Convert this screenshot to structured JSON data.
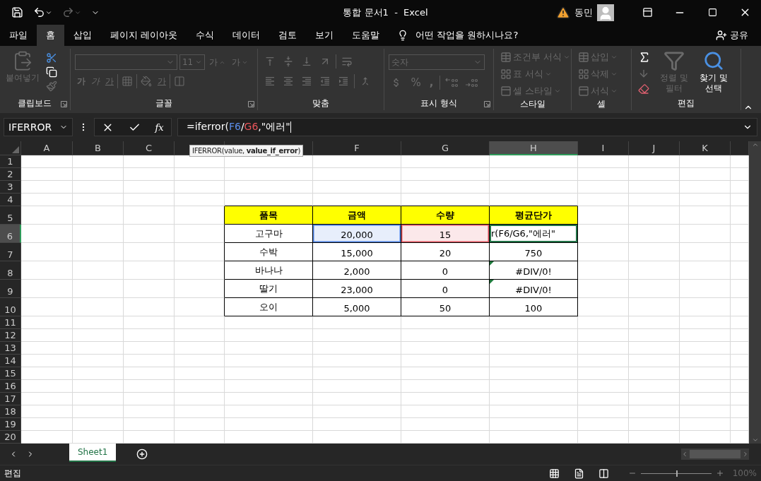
{
  "title_bar": {
    "title": "통합 문서1  -  Excel",
    "user": "동민"
  },
  "menu_tabs": [
    {
      "label": "파일",
      "selected": false
    },
    {
      "label": "홈",
      "selected": true
    },
    {
      "label": "삽입",
      "selected": false
    },
    {
      "label": "페이지 레이아웃",
      "selected": false
    },
    {
      "label": "수식",
      "selected": false
    },
    {
      "label": "데이터",
      "selected": false
    },
    {
      "label": "검토",
      "selected": false
    },
    {
      "label": "보기",
      "selected": false
    },
    {
      "label": "도움말",
      "selected": false
    }
  ],
  "tell_me": "어떤 작업을 원하시나요?",
  "share": "공유",
  "ribbon": {
    "groups": [
      {
        "kind": "clipboard",
        "label": "클립보드",
        "paste": {
          "label": "붙여넣기",
          "disabled": true
        }
      },
      {
        "kind": "font",
        "label": "글꼴",
        "disabled": true,
        "font_size": "11",
        "buttons": [
          {
            "kind": "grow",
            "label": "가"
          },
          {
            "kind": "shrink",
            "label": "가"
          },
          {
            "kind": "bold",
            "label": "가"
          },
          {
            "kind": "italic",
            "label": "가"
          },
          {
            "kind": "underline",
            "label": "가"
          },
          {
            "kind": "font-color",
            "label": "가"
          }
        ]
      },
      {
        "kind": "alignment",
        "label": "맞춤",
        "disabled": true
      },
      {
        "kind": "number",
        "label": "표시 형식",
        "disabled": true,
        "format": "숫자",
        "percent": "%",
        "comma": ","
      },
      {
        "kind": "list",
        "label": "스타일",
        "items": [
          {
            "label": "조건부 서식",
            "disabled": true
          },
          {
            "label": "표 서식",
            "disabled": true
          },
          {
            "label": "셀 스타일",
            "disabled": true
          }
        ]
      },
      {
        "kind": "list",
        "label": "셀",
        "items": [
          {
            "label": "삽입",
            "disabled": true
          },
          {
            "label": "삭제",
            "disabled": true
          },
          {
            "label": "서식",
            "disabled": true
          }
        ]
      },
      {
        "kind": "editing",
        "label": "편집",
        "items": [
          {
            "label": "정렬 및 필터",
            "disabled": true
          },
          {
            "label": "찾기 및 선택",
            "disabled": false
          }
        ]
      }
    ]
  },
  "formula_bar": {
    "name_box": "IFERROR",
    "function_button": "fx",
    "segments": [
      {
        "text": "=iferror(",
        "color": "#ffffff"
      },
      {
        "text": "F6",
        "color": "#5b8de8"
      },
      {
        "text": "/",
        "color": "#ffffff"
      },
      {
        "text": "G6",
        "color": "#e8555a"
      },
      {
        "text": ",\"에러\"",
        "color": "#ffffff"
      }
    ],
    "tooltip": "IFERROR(value, **value_if_error**)"
  },
  "sheet": {
    "columns": [
      {
        "label": "A",
        "selected": false
      },
      {
        "label": "B",
        "selected": false
      },
      {
        "label": "C",
        "selected": false
      },
      {
        "selected": false
      },
      {
        "selected": false
      },
      {
        "label": "F",
        "selected": false
      },
      {
        "label": "G",
        "selected": false
      },
      {
        "label": "H",
        "selected": true
      },
      {
        "label": "I",
        "selected": false
      },
      {
        "label": "J",
        "selected": false
      },
      {
        "label": "K",
        "selected": false
      }
    ],
    "rows": [
      {
        "label": "1",
        "selected": false
      },
      {
        "label": "2",
        "selected": false
      },
      {
        "label": "3",
        "selected": false
      },
      {
        "label": "4",
        "selected": false
      },
      {
        "label": "5",
        "selected": false
      },
      {
        "label": "6",
        "selected": true
      },
      {
        "label": "7",
        "selected": false
      },
      {
        "label": "8",
        "selected": false
      },
      {
        "label": "9",
        "selected": false
      },
      {
        "label": "10",
        "selected": false
      },
      {
        "label": "11",
        "selected": false
      },
      {
        "label": "12",
        "selected": false
      },
      {
        "label": "13",
        "selected": false
      },
      {
        "label": "14",
        "selected": false
      },
      {
        "label": "15",
        "selected": false
      },
      {
        "label": "16",
        "selected": false
      },
      {
        "label": "17",
        "selected": false
      },
      {
        "label": "18",
        "selected": false
      },
      {
        "label": "19",
        "selected": false
      },
      {
        "label": "20",
        "selected": false
      }
    ]
  },
  "table": {
    "header": [
      "품목",
      "금액",
      "수량",
      "평균단가"
    ],
    "rows": [
      [
        {
          "text": "고구마",
          "active": false,
          "flagged": false
        },
        {
          "text": "20,000",
          "color": "#4a7fe0",
          "active": false,
          "flagged": false
        },
        {
          "text": "15",
          "color": "#e05560",
          "active": false,
          "flagged": false
        },
        {
          "text": "r(F6/G6,\"에러\"",
          "active": true,
          "flagged": false
        }
      ],
      [
        {
          "text": "수박",
          "active": false,
          "flagged": false
        },
        {
          "text": "15,000",
          "active": false,
          "flagged": false
        },
        {
          "text": "20",
          "active": false,
          "flagged": false
        },
        {
          "text": "750",
          "active": false,
          "flagged": false
        }
      ],
      [
        {
          "text": "바나나",
          "active": false,
          "flagged": false
        },
        {
          "text": "2,000",
          "active": false,
          "flagged": false
        },
        {
          "text": "0",
          "active": false,
          "flagged": false
        },
        {
          "text": "#DIV/0!",
          "active": false,
          "flagged": true
        }
      ],
      [
        {
          "text": "딸기",
          "active": false,
          "flagged": false
        },
        {
          "text": "23,000",
          "active": false,
          "flagged": false
        },
        {
          "text": "0",
          "active": false,
          "flagged": false
        },
        {
          "text": "#DIV/0!",
          "active": false,
          "flagged": true
        }
      ],
      [
        {
          "text": "오이",
          "active": false,
          "flagged": false
        },
        {
          "text": "5,000",
          "active": false,
          "flagged": false
        },
        {
          "text": "50",
          "active": false,
          "flagged": false
        },
        {
          "text": "100",
          "active": false,
          "flagged": false
        }
      ]
    ]
  },
  "sheet_tabs": [
    {
      "label": "Sheet1",
      "selected": true
    }
  ],
  "status_bar": {
    "mode": "편집",
    "views": [
      {
        "kind": "normal"
      },
      {
        "kind": "page-layout"
      },
      {
        "kind": "page-break"
      }
    ],
    "zoom": {
      "level": 0.5,
      "reading": "100%"
    }
  }
}
